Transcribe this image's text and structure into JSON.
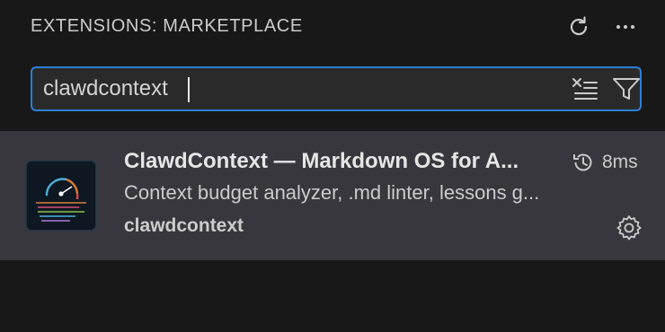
{
  "header": {
    "title": "EXTENSIONS: MARKETPLACE",
    "refresh_icon": "refresh-icon",
    "more_icon": "ellipsis-icon"
  },
  "search": {
    "value": "clawdcontext",
    "clear_icon": "clear-results-icon",
    "filter_icon": "filter-icon"
  },
  "extension": {
    "name": "ClawdContext — Markdown OS for A...",
    "description": "Context budget analyzer, .md linter, lessons g...",
    "publisher": "clawdcontext",
    "install_time": "8ms",
    "history_icon": "history-icon",
    "settings_icon": "gear-icon",
    "logo_icon": "gauge-logo-icon"
  },
  "colors": {
    "background": "#181818",
    "accent": "#2b7fd6",
    "selected_row": "#37373d"
  }
}
